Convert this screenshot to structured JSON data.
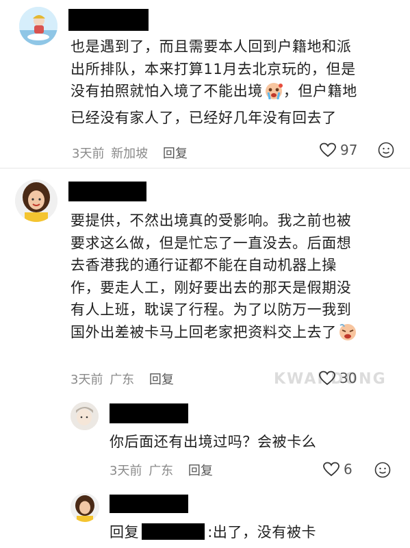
{
  "comments": [
    {
      "text": "也是遇到了，而且需要本人回到户籍地和派\n出所排队，本来打算11月去北京玩的，但是\n没有拍照就怕入境了不能出境",
      "text_tail": "，但户籍地\n已经没有家人了，已经好几年没有回去了",
      "time": "3天前",
      "location": "新加坡",
      "reply_label": "回复",
      "likes": "97"
    },
    {
      "text": "要提供，不然出境真的受影响。我之前也被\n要求这么做，但是忙忘了一直没去。后面想\n去香港我的通行证都不能在自动机器上操\n作，要走人工，刚好要出去的那天是假期没\n有人上班，耽误了行程。为了以防万一我到\n国外出差被卡马上回老家把资料交上去了",
      "time": "3天前",
      "location": "广东",
      "reply_label": "回复",
      "likes": "30"
    }
  ],
  "replies": [
    {
      "text": "你后面还有出境过吗？会被卡么",
      "time": "3天前",
      "location": "广东",
      "reply_label": "回复",
      "likes": "6"
    },
    {
      "prefix": "回复",
      "text": ":出了，没有被卡"
    }
  ],
  "watermark": "KWAI DONG",
  "icons": [
    "heart-icon",
    "comment-emoji-icon",
    "crying-emoji-icon",
    "tired-emoji-icon"
  ]
}
